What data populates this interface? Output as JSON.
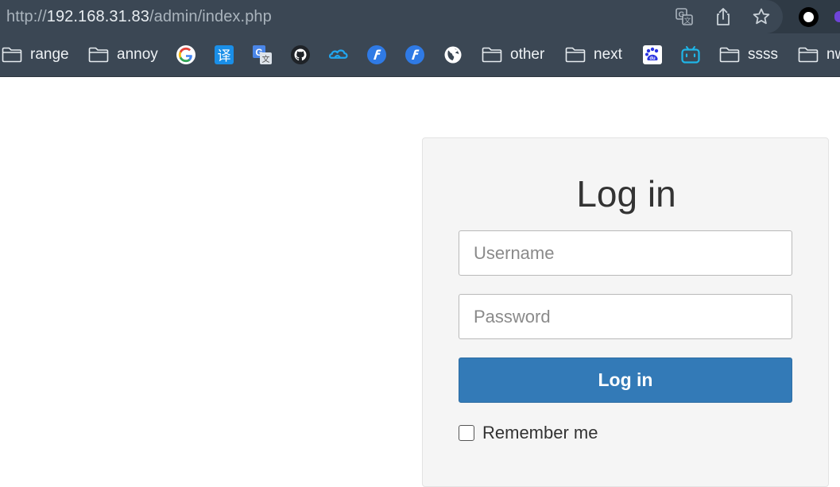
{
  "address_bar": {
    "url_scheme": "http://",
    "url_host": "192.168.31.83",
    "url_path": "/admin/index.php",
    "icons": [
      "translate-icon",
      "share-icon",
      "bookmark-star-icon",
      "profile-icon"
    ]
  },
  "bookmarks": {
    "items": [
      {
        "type": "folder",
        "label": "range"
      },
      {
        "type": "folder",
        "label": "annoy"
      },
      {
        "type": "icon",
        "icon": "google-icon"
      },
      {
        "type": "icon",
        "icon": "translate-yi-icon"
      },
      {
        "type": "icon",
        "icon": "google-translate-icon"
      },
      {
        "type": "icon",
        "icon": "github-icon"
      },
      {
        "type": "icon",
        "icon": "cloud-icon"
      },
      {
        "type": "icon",
        "icon": "f-app-icon"
      },
      {
        "type": "icon",
        "icon": "f-app-icon"
      },
      {
        "type": "icon",
        "icon": "globe-icon"
      },
      {
        "type": "folder",
        "label": "other"
      },
      {
        "type": "folder",
        "label": "next"
      },
      {
        "type": "icon",
        "icon": "baidu-icon"
      },
      {
        "type": "icon",
        "icon": "bilibili-icon"
      },
      {
        "type": "folder",
        "label": "ssss"
      },
      {
        "type": "folder",
        "label": "nw"
      }
    ]
  },
  "login": {
    "title": "Log in",
    "username_placeholder": "Username",
    "password_placeholder": "Password",
    "button_label": "Log in",
    "remember_label": "Remember me",
    "remember_checked": false
  },
  "colors": {
    "button_blue": "#337ab7",
    "toolbar_dark": "#3b4754"
  }
}
